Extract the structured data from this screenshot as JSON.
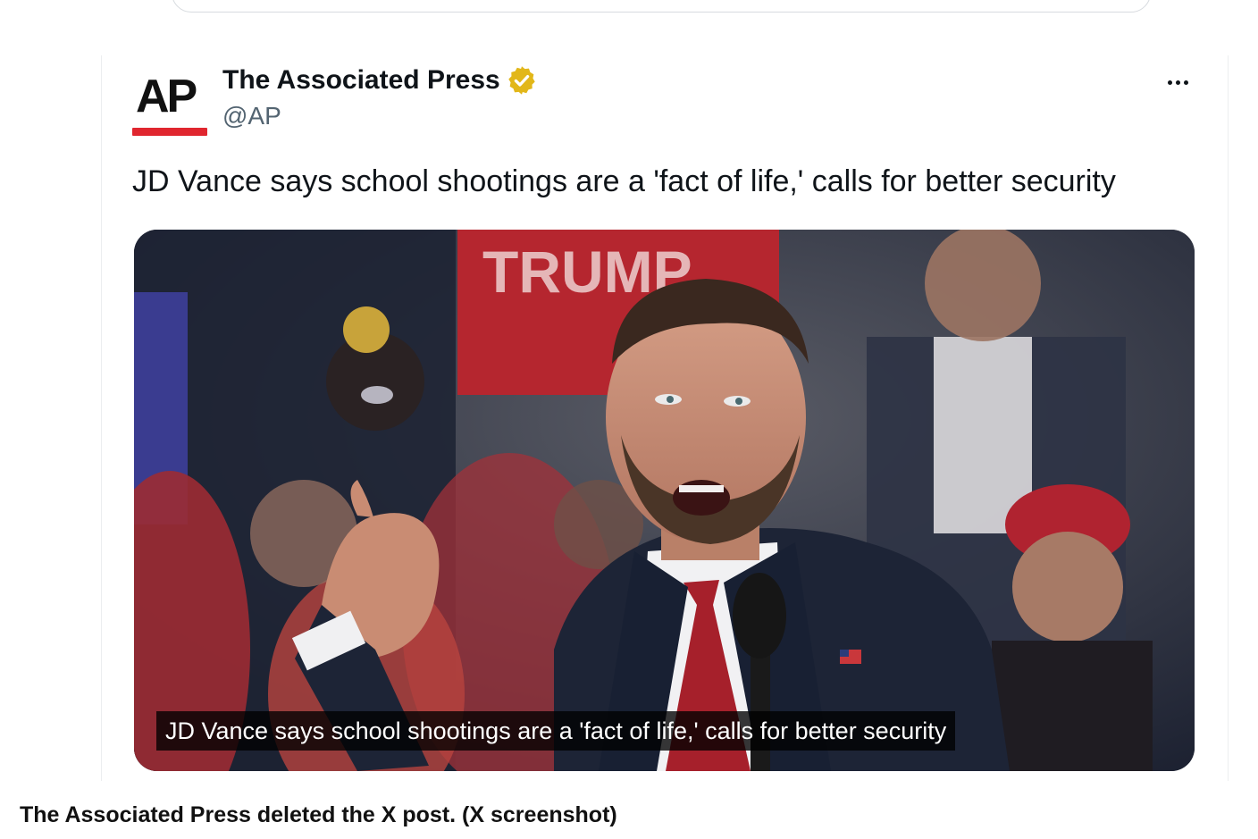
{
  "post": {
    "author_name": "The Associated Press",
    "handle": "@AP",
    "logo_text": "AP",
    "text": "JD Vance says school shootings are a 'fact of life,' calls for better security",
    "media": {
      "caption_overlay": "JD Vance says school shootings are a 'fact of life,' calls for better security",
      "sign_text": "TRUMP"
    }
  },
  "page": {
    "photo_caption": "The Associated Press deleted the X post. (X screenshot)"
  },
  "icons": {
    "verified": "verified-badge-icon",
    "more": "more-options-icon"
  },
  "colors": {
    "ap_red": "#e0262f",
    "verified_gold": "#e2b719",
    "handle_gray": "#536471"
  }
}
